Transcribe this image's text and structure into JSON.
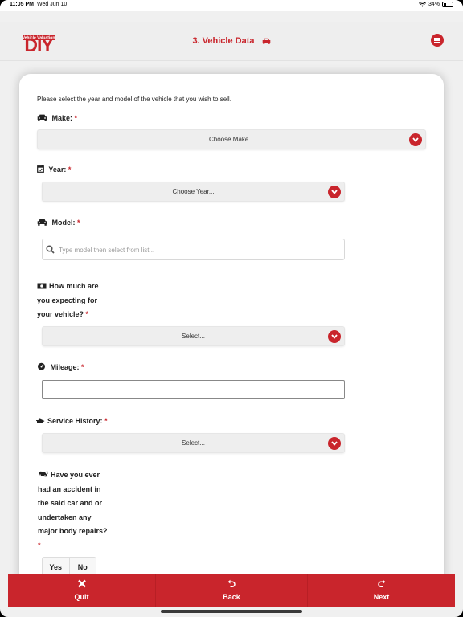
{
  "status_bar": {
    "time": "11:05 PM",
    "date": "Wed Jun 10",
    "battery": "34%",
    "battery_level": 0.34
  },
  "header": {
    "logo_text": "DIY",
    "logo_subtext": "Vehicle Valuation",
    "title": "3. Vehicle Data",
    "icons": [
      "car-icon",
      "menu-icon"
    ]
  },
  "form": {
    "intro": "Please select the year and model of the vehicle that you wish to sell.",
    "required_mark": "*",
    "make": {
      "label": "Make:",
      "value": "Choose Make...",
      "icon": "car-front-icon"
    },
    "year": {
      "label": "Year:",
      "value": "Choose Year...",
      "icon": "calendar-icon"
    },
    "model": {
      "label": "Model:",
      "placeholder": "Type model then select from list...",
      "icon": "car-front-icon"
    },
    "expected": {
      "label_lines": [
        "How much are",
        "you expecting for",
        "your vehicle?"
      ],
      "value": "Select...",
      "icon": "money-icon"
    },
    "mileage": {
      "label": "Mileage:",
      "value": "",
      "icon": "gauge-icon"
    },
    "service": {
      "label": "Service History:",
      "value": "Select...",
      "icon": "oil-can-icon"
    },
    "accident": {
      "label_lines": [
        "Have you ever",
        "had an accident in",
        "the said car and or",
        "undertaken any",
        "major body repairs?"
      ],
      "icon": "car-crash-icon",
      "options": [
        "Yes",
        "No"
      ]
    }
  },
  "footer": {
    "quit": {
      "label": "Quit",
      "icon": "close-icon"
    },
    "back": {
      "label": "Back",
      "icon": "undo-icon"
    },
    "next": {
      "label": "Next",
      "icon": "redo-icon"
    }
  },
  "colors": {
    "accent": "#c9252c",
    "background": "#f0f0f0",
    "card": "#ffffff"
  }
}
